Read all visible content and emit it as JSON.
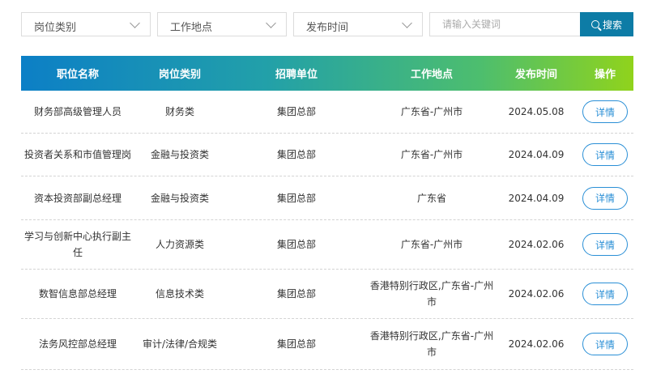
{
  "filters": {
    "category": "岗位类别",
    "location": "工作地点",
    "time": "发布时间",
    "search_placeholder": "请输入关键词",
    "search_button": "搜索"
  },
  "table": {
    "headers": [
      "职位名称",
      "岗位类别",
      "招聘单位",
      "工作地点",
      "发布时间",
      "操作"
    ],
    "detail_label": "详情",
    "rows": [
      {
        "name": "财务部高级管理人员",
        "category": "财务类",
        "unit": "集团总部",
        "location": "广东省-广州市",
        "date": "2024.05.08"
      },
      {
        "name": "投资者关系和市值管理岗",
        "category": "金融与投资类",
        "unit": "集团总部",
        "location": "广东省-广州市",
        "date": "2024.04.09"
      },
      {
        "name": "资本投资部副总经理",
        "category": "金融与投资类",
        "unit": "集团总部",
        "location": "广东省",
        "date": "2024.04.09"
      },
      {
        "name": "学习与创新中心执行副主任",
        "category": "人力资源类",
        "unit": "集团总部",
        "location": "广东省-广州市",
        "date": "2024.02.06"
      },
      {
        "name": "数智信息部总经理",
        "category": "信息技术类",
        "unit": "集团总部",
        "location": "香港特别行政区,广东省-广州市",
        "date": "2024.02.06"
      },
      {
        "name": "法务风控部总经理",
        "category": "审计/法律/合规类",
        "unit": "集团总部",
        "location": "香港特别行政区,广东省-广州市",
        "date": "2024.02.06"
      }
    ]
  }
}
